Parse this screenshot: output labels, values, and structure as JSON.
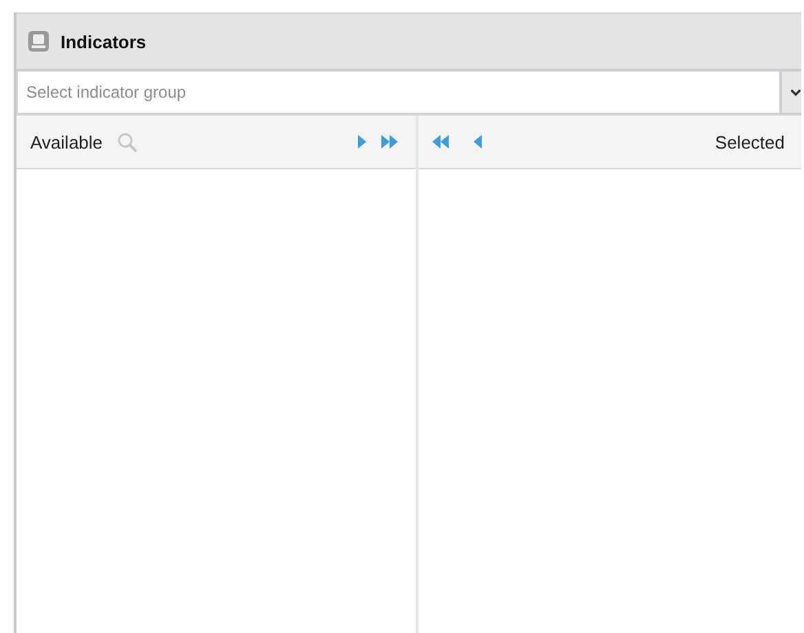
{
  "panel": {
    "title": "Indicators"
  },
  "group_select": {
    "placeholder": "Select indicator group"
  },
  "available": {
    "label": "Available"
  },
  "selected": {
    "label": "Selected"
  }
}
